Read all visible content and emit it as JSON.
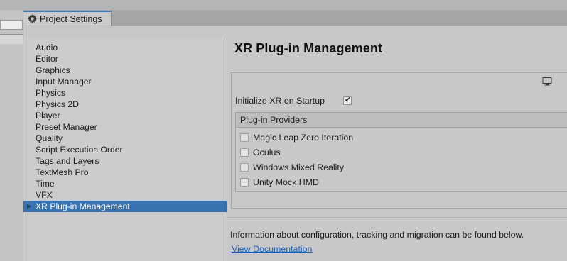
{
  "window": {
    "title": "Project Settings",
    "tab_icon": "gear-icon"
  },
  "sidebar": {
    "items": [
      {
        "label": "Audio"
      },
      {
        "label": "Editor"
      },
      {
        "label": "Graphics"
      },
      {
        "label": "Input Manager"
      },
      {
        "label": "Physics"
      },
      {
        "label": "Physics 2D"
      },
      {
        "label": "Player"
      },
      {
        "label": "Preset Manager"
      },
      {
        "label": "Quality"
      },
      {
        "label": "Script Execution Order"
      },
      {
        "label": "Tags and Layers"
      },
      {
        "label": "TextMesh Pro"
      },
      {
        "label": "Time"
      },
      {
        "label": "VFX"
      },
      {
        "label": "XR Plug-in Management",
        "selected": true
      }
    ]
  },
  "main": {
    "title": "XR Plug-in Management",
    "platform_icon": "monitor-icon",
    "initialize_label": "Initialize XR on Startup",
    "initialize_checked": true,
    "providers_header": "Plug-in Providers",
    "providers": [
      {
        "label": "Magic Leap Zero Iteration",
        "checked": false
      },
      {
        "label": "Oculus",
        "checked": false
      },
      {
        "label": "Windows Mixed Reality",
        "checked": false
      },
      {
        "label": "Unity Mock HMD",
        "checked": false
      }
    ],
    "info_text": "Information about configuration, tracking and migration can be found below.",
    "docs_link": "View Documentation"
  },
  "colors": {
    "selection": "#3a72b0",
    "link": "#1a5fbf",
    "tab_accent": "#3a79bb"
  }
}
